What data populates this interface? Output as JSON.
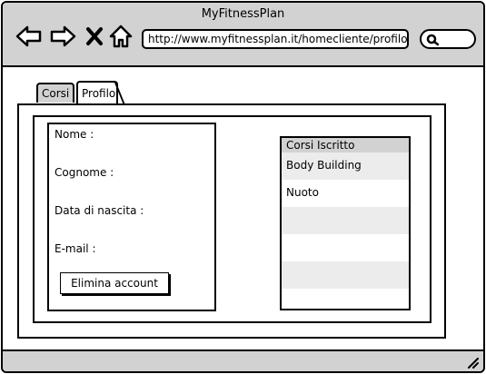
{
  "window": {
    "title": "MyFitnessPlan",
    "url": "http://www.myfitnessplan.it/homecliente/profilo"
  },
  "nav_icons": [
    "back-arrow-icon",
    "forward-arrow-icon",
    "close-x-icon",
    "home-icon"
  ],
  "tabs": [
    {
      "label": "Corsi",
      "active": false
    },
    {
      "label": "Profilo",
      "active": true
    }
  ],
  "profile": {
    "fields": [
      "Nome :",
      "Cognome :",
      "Data di nascita :",
      "E-mail :"
    ],
    "delete_button": "Elimina account"
  },
  "courses": {
    "header": "Corsi Iscritto",
    "rows": [
      "Body Building",
      "Nuoto",
      "",
      "",
      "",
      ""
    ]
  },
  "colors": {
    "chrome": "#d2d2d2",
    "alt_row": "#ececec",
    "border": "#000000"
  }
}
